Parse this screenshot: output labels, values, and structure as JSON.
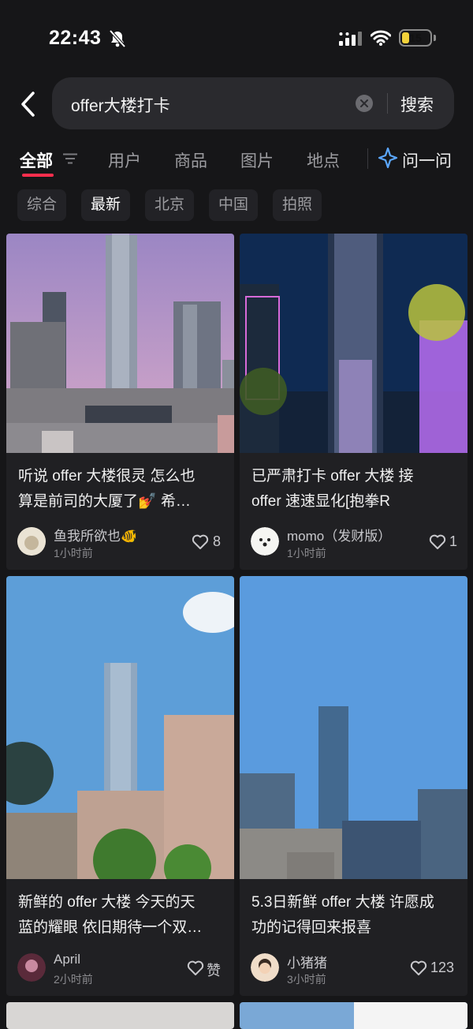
{
  "status_bar": {
    "time": "22:43",
    "battery": "15"
  },
  "search": {
    "query": "offer大楼打卡",
    "button": "搜索"
  },
  "tabs": [
    {
      "label": "全部"
    },
    {
      "label": "用户"
    },
    {
      "label": "商品"
    },
    {
      "label": "图片"
    },
    {
      "label": "地点"
    }
  ],
  "ask": {
    "label": "问一问"
  },
  "chips": [
    {
      "label": "综合"
    },
    {
      "label": "最新"
    },
    {
      "label": "北京"
    },
    {
      "label": "中国"
    },
    {
      "label": "拍照"
    }
  ],
  "colors": {
    "accent": "#ff2e4d",
    "background": "#161618",
    "card": "#202023"
  },
  "cards": [
    {
      "title_line1": "听说 offer 大楼很灵 怎么也",
      "title_line2": "算是前司的大厦了💅 希…",
      "user": "鱼我所欲也🐠",
      "time": "1小时前",
      "likes": "8"
    },
    {
      "title_line1": "已严肃打卡 offer 大楼 接",
      "title_line2": "offer 速速显化[抱拳R",
      "user": "momo（发财版）",
      "time": "1小时前",
      "likes": "1"
    },
    {
      "title_line1": "新鲜的 offer 大楼 今天的天",
      "title_line2": "蓝的耀眼 依旧期待一个双…",
      "user": "April",
      "time": "2小时前",
      "likes": "赞"
    },
    {
      "title_line1": "5.3日新鲜 offer 大楼 许愿成",
      "title_line2": "功的记得回来报喜",
      "user": "小猪猪",
      "time": "3小时前",
      "likes": "123"
    }
  ]
}
